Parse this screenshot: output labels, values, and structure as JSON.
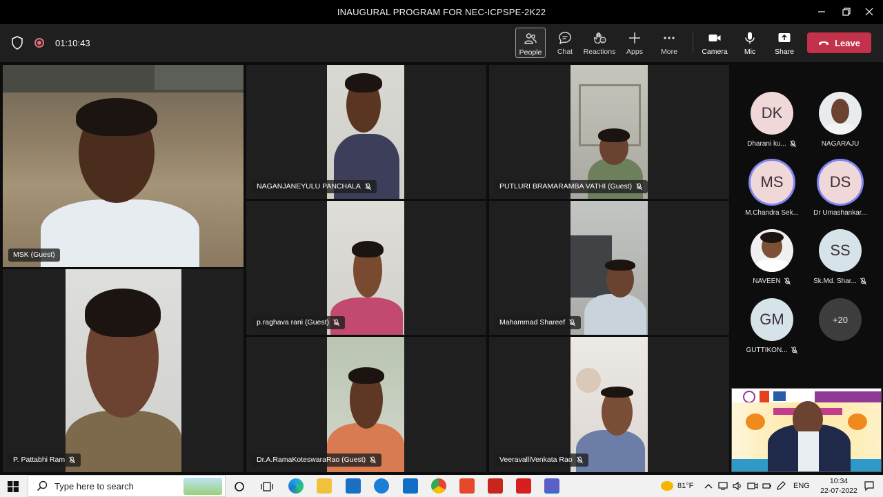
{
  "window": {
    "title": "INAUGURAL PROGRAM FOR NEC-ICPSPE-2K22"
  },
  "toolbar": {
    "timer": "01:10:43",
    "buttons": [
      {
        "label": "People",
        "icon": "people-icon"
      },
      {
        "label": "Chat",
        "icon": "chat-icon"
      },
      {
        "label": "Reactions",
        "icon": "reactions-icon"
      },
      {
        "label": "Apps",
        "icon": "plus-icon"
      },
      {
        "label": "More",
        "icon": "more-icon"
      },
      {
        "label": "Camera",
        "icon": "camera-icon"
      },
      {
        "label": "Mic",
        "icon": "mic-icon"
      },
      {
        "label": "Share",
        "icon": "share-icon"
      }
    ],
    "leave_label": "Leave"
  },
  "tiles": [
    {
      "name": "MSK (Guest)"
    },
    {
      "name": "NAGANJANEYULU PANCHALA"
    },
    {
      "name": "PUTLURI BRAMARAMBA VATHI (Guest)"
    },
    {
      "name": "p.raghava rani (Guest)"
    },
    {
      "name": "Mahammad Shareef"
    },
    {
      "name": "P. Pattabhi Ram"
    },
    {
      "name": "Dr.A.RamaKoteswaraRao (Guest)"
    },
    {
      "name": "VeeravalliVenkata Rao"
    }
  ],
  "roster": [
    {
      "initials": "DK",
      "name": "Dharani ku..."
    },
    {
      "initials": "",
      "name": "NAGARAJU"
    },
    {
      "initials": "MS",
      "name": "M.Chandra Sek..."
    },
    {
      "initials": "DS",
      "name": "Dr Umashankar..."
    },
    {
      "initials": "",
      "name": "NAVEEN"
    },
    {
      "initials": "SS",
      "name": "Sk.Md. Shar..."
    },
    {
      "initials": "GM",
      "name": "GUTTIKON..."
    },
    {
      "initials": "+20",
      "name": ""
    }
  ],
  "taskbar": {
    "search_placeholder": "Type here to search",
    "temperature": "81°F",
    "language": "ENG",
    "time": "10:34",
    "date": "22-07-2022"
  }
}
